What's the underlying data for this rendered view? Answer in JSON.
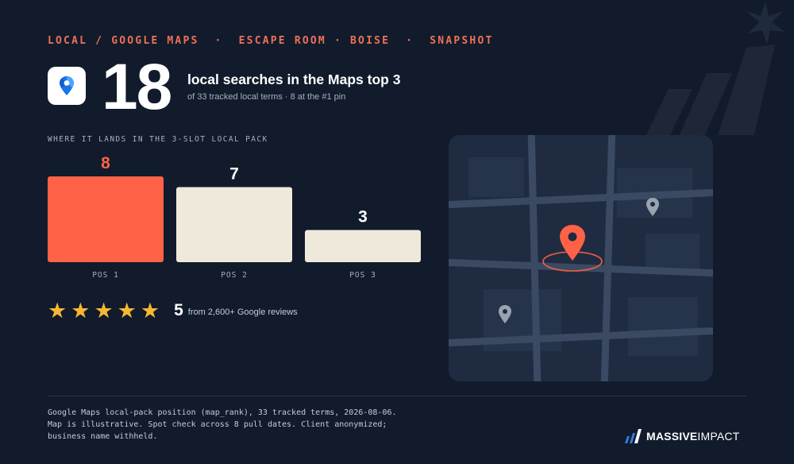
{
  "header": {
    "eyebrow": "LOCAL / GOOGLE MAPS  ·  ESCAPE ROOM · BOISE  ·  SNAPSHOT",
    "app_icon": "google-maps-pin-icon",
    "big_number": "18",
    "headline": "local searches in the Maps top 3",
    "subline": "of 33 tracked local terms · 8 at the #1 pin"
  },
  "chart_data": {
    "type": "bar",
    "title": "WHERE IT LANDS IN THE 3-SLOT LOCAL PACK",
    "categories": [
      "POS 1",
      "POS 2",
      "POS 3"
    ],
    "values": [
      8,
      7,
      3
    ],
    "value_labels": [
      "8",
      "7",
      "3"
    ],
    "ylim": [
      0,
      8
    ],
    "bar_colors": [
      "#ff6247",
      "#efe9dc",
      "#efe9dc"
    ],
    "value_label_colors": [
      "#ff6247",
      "#ffffff",
      "#ffffff"
    ],
    "grid": false
  },
  "rating": {
    "stars": 5,
    "max_stars": 5,
    "value": "5",
    "text": "from 2,600+ Google reviews",
    "icon": "star-icon",
    "star_color": "#f6b731"
  },
  "map": {
    "icon": "map-illustration",
    "pins": [
      "location-pin-icon",
      "location-pin-icon",
      "location-pin-icon"
    ],
    "highlight_pin_color": "#ff6247",
    "pin_color": "#9aa3b2"
  },
  "footnote": {
    "line1": "Google Maps local-pack position (map_rank), 33 tracked terms, 2026-08-06.",
    "line2": "Map is illustrative. Spot check across 8 pull dates. Client anonymized;",
    "line3": "business name withheld."
  },
  "brand": {
    "part1": "MASSIVE",
    "part2": "IMPACT",
    "icon": "bar-chart-logo-icon"
  },
  "colors": {
    "background": "#111b2c",
    "accent": "#ff6247",
    "cream": "#efe9dc"
  }
}
